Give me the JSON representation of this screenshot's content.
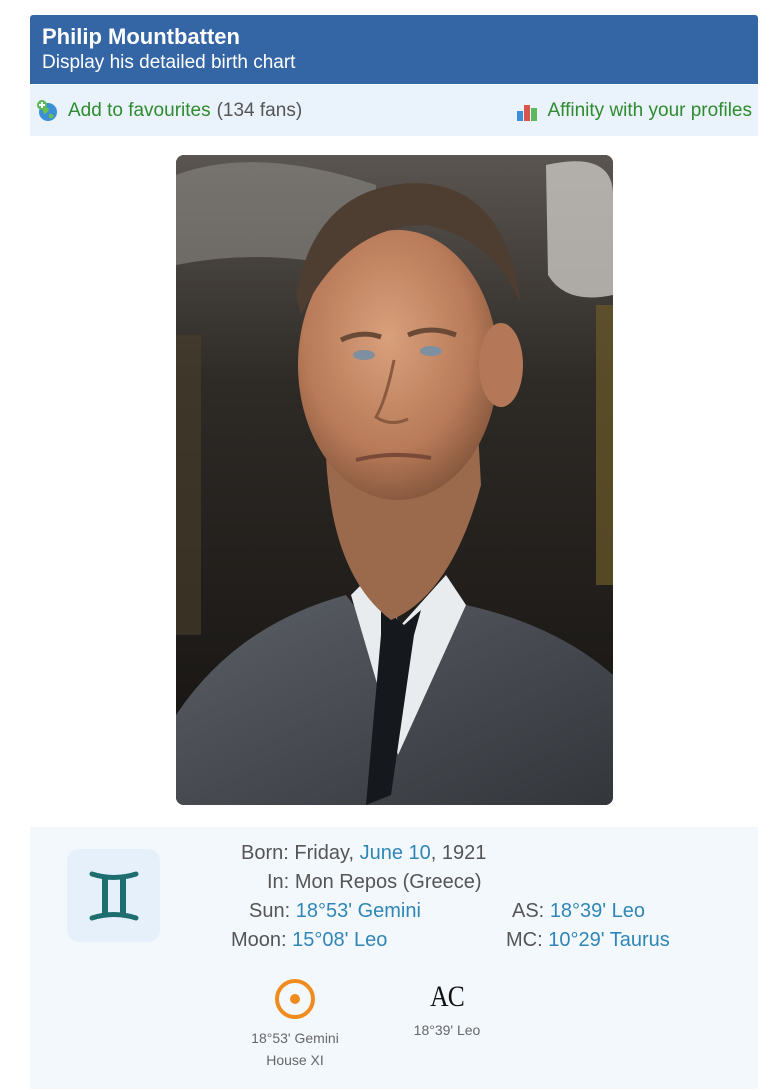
{
  "header": {
    "title": "Philip Mountbatten",
    "subtitle": "Display his detailed birth chart"
  },
  "actions": {
    "favourites_label": "Add to favourites",
    "favourites_count": "(134 fans)",
    "affinity_label": "Affinity with your profiles"
  },
  "colors": {
    "header_bg": "#3465a4",
    "action_green": "#2e8b2e",
    "link_blue": "#2f86b6",
    "sun_orange": "#f08c1e",
    "gemini_teal": "#1e6e70"
  },
  "sign_icon": "gemini-icon",
  "birth": {
    "born_label": "Born:",
    "born_day": "Friday,",
    "born_date": "June 10",
    "born_year": ", 1921",
    "in_label": "In:",
    "in_place": "Mon Repos (Greece)",
    "sun_label": "Sun:",
    "sun_value": "18°53' Gemini",
    "moon_label": "Moon:",
    "moon_value": "15°08' Leo",
    "as_label": "AS:",
    "as_value": "18°39' Leo",
    "mc_label": "MC:",
    "mc_value": "10°29' Taurus"
  },
  "highlights": {
    "sun": {
      "icon": "sun-icon",
      "position": "18°53' Gemini",
      "house": "House XI"
    },
    "ascendant": {
      "glyph": "AC",
      "position": "18°39' Leo"
    }
  }
}
